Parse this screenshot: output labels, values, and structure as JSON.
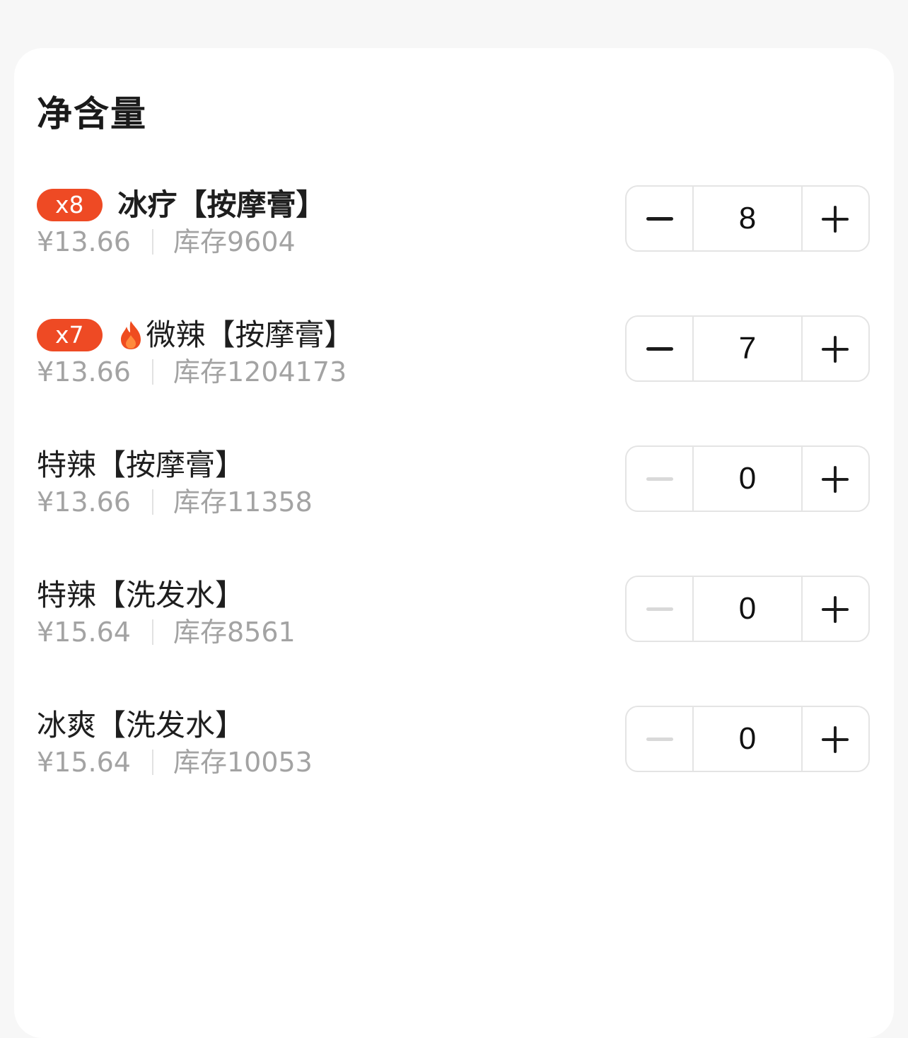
{
  "section": {
    "title": "净含量"
  },
  "items": [
    {
      "badge": "x8",
      "has_fire": false,
      "name": "冰疗【按摩膏】",
      "price": "¥13.66",
      "stock": "库存9604",
      "quantity": "8",
      "minus_enabled": true
    },
    {
      "badge": "x7",
      "has_fire": true,
      "name": "微辣【按摩膏】",
      "price": "¥13.66",
      "stock": "库存1204173",
      "quantity": "7",
      "minus_enabled": true
    },
    {
      "badge": "",
      "has_fire": false,
      "name": "特辣【按摩膏】",
      "price": "¥13.66",
      "stock": "库存11358",
      "quantity": "0",
      "minus_enabled": false
    },
    {
      "badge": "",
      "has_fire": false,
      "name": "特辣【洗发水】",
      "price": "¥15.64",
      "stock": "库存8561",
      "quantity": "0",
      "minus_enabled": false
    },
    {
      "badge": "",
      "has_fire": false,
      "name": "冰爽【洗发水】",
      "price": "¥15.64",
      "stock": "库存10053",
      "quantity": "0",
      "minus_enabled": false
    }
  ],
  "icons": {
    "minus": "minus-icon",
    "plus": "plus-icon",
    "fire": "fire-icon"
  },
  "colors": {
    "badge_bg": "#ee4a24",
    "fire": "#ef4c1f",
    "text_primary": "#1e1e1e",
    "text_secondary": "#a3a3a3",
    "minus_disabled": "#d9d9d9"
  }
}
